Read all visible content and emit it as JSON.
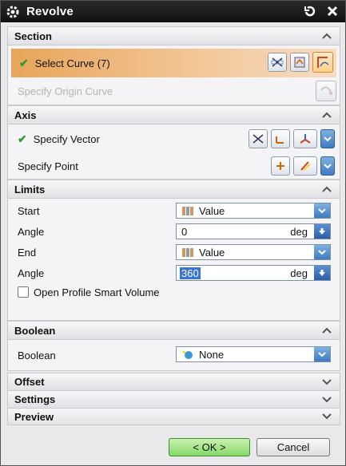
{
  "window": {
    "title": "Revolve"
  },
  "sections": {
    "section": {
      "label": "Section",
      "select_curve": "Select Curve (7)",
      "origin_curve": "Specify Origin Curve"
    },
    "axis": {
      "label": "Axis",
      "vector": "Specify Vector",
      "point": "Specify Point"
    },
    "limits": {
      "label": "Limits",
      "start_label": "Start",
      "start_value": "Value",
      "angle1_label": "Angle",
      "angle1_value": "0",
      "angle1_unit": "deg",
      "end_label": "End",
      "end_value": "Value",
      "angle2_label": "Angle",
      "angle2_value": "360",
      "angle2_unit": "deg",
      "open_profile": "Open Profile Smart Volume"
    },
    "boolean": {
      "label": "Boolean",
      "row_label": "Boolean",
      "value": "None"
    },
    "offset": {
      "label": "Offset"
    },
    "settings": {
      "label": "Settings"
    },
    "preview": {
      "label": "Preview"
    }
  },
  "buttons": {
    "ok": "< OK >",
    "cancel": "Cancel"
  },
  "colors": {
    "selected_row": "#e8a55a",
    "check": "#2e9b2e",
    "highlight": "#3875d7"
  }
}
